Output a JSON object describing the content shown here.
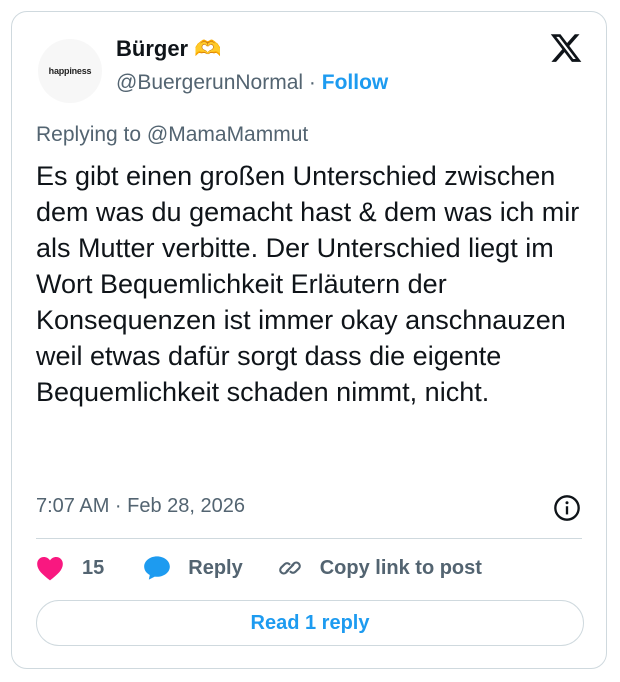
{
  "author": {
    "display_name": "Bürger 🫶",
    "handle": "@BuergerunNormal",
    "separator": "·",
    "follow_label": "Follow",
    "avatar_text": "happiness"
  },
  "reply_context": {
    "prefix": "Replying to",
    "mention": "@MamaMammut"
  },
  "post": {
    "text": "Es gibt einen großen Unterschied zwischen dem was du gemacht hast & dem was ich mir als Mutter verbitte. Der Unterschied liegt im Wort Bequemlichkeit Erläutern der Konsequenzen ist immer okay anschnauzen weil etwas dafür sorgt dass die eigente Bequemlichkeit schaden nimmt, nicht.",
    "timestamp": "7:07 AM · Feb 28, 2026"
  },
  "actions": {
    "like_count": "15",
    "reply_label": "Reply",
    "copy_label": "Copy link to post"
  },
  "read_reply_label": "Read 1 reply",
  "colors": {
    "accent": "#1d9bf0",
    "like": "#f91880",
    "muted": "#536471",
    "border": "#cfd9de"
  },
  "icons": {
    "logo": "x-logo-icon",
    "info": "info-icon",
    "like": "heart-icon",
    "reply": "speech-bubble-icon",
    "copy": "link-icon"
  }
}
